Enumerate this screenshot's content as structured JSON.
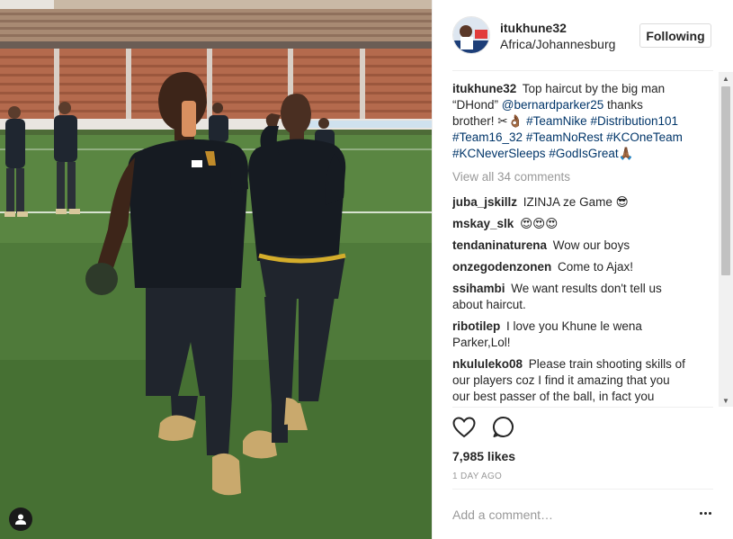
{
  "post": {
    "username": "itukhune32",
    "location": "Africa/Johannesburg",
    "follow_label": "Following",
    "likes": "7,985 likes",
    "timestamp": "1 DAY AGO",
    "add_comment_placeholder": "Add a comment…",
    "view_all": "View all 34 comments"
  },
  "caption": {
    "user": "itukhune32",
    "parts": [
      "Top haircut by the big man “DHond” ",
      "@bernardparker25",
      " thanks brother! ✂👌🏾 ",
      "#TeamNike",
      " ",
      "#Distribution101",
      " ",
      "#Team16_32",
      " ",
      "#TeamNoRest",
      " ",
      "#KCOneTeam",
      " ",
      "#KCNeverSleeps",
      " ",
      "#GodIsGreat",
      "🙏🏾"
    ]
  },
  "comments": [
    {
      "user": "juba_jskillz",
      "text": "IZINJA ze Game 😎"
    },
    {
      "user": "mskay_slk",
      "text": "😍😍😍"
    },
    {
      "user": "tendaninaturena",
      "text": "Wow our boys"
    },
    {
      "user": "onzegodenzonen",
      "text": "Come to Ajax!"
    },
    {
      "user": "ssihambi",
      "text": "We want results don't tell us about haircut."
    },
    {
      "user": "ribotilep",
      "text": "I love you Khune le wena Parker,Lol!"
    },
    {
      "user": "nkululeko08",
      "text": "Please train shooting skills of our players coz I find it amazing that you our best passer of the ball, in fact you"
    }
  ],
  "icons": {
    "like": "heart-outline-icon",
    "comment": "speech-bubble-icon",
    "more": "three-dots-icon",
    "user_tag": "person-tag-icon"
  },
  "colors": {
    "hashtag": "#003569",
    "muted": "#999999",
    "text": "#262626"
  }
}
